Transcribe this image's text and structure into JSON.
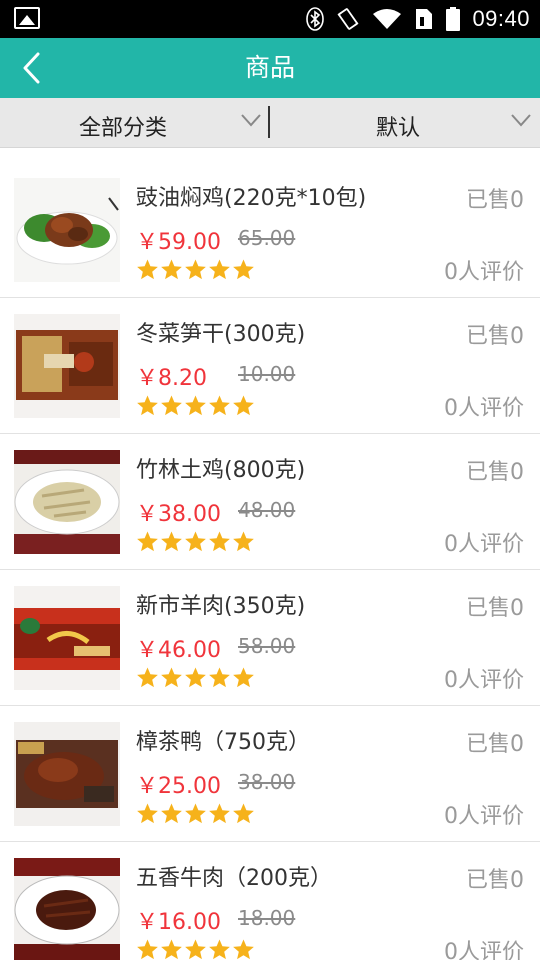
{
  "status_bar": {
    "time": "09:40",
    "icons": [
      "image-icon",
      "bluetooth-icon",
      "vibrate-icon",
      "wifi-icon",
      "sim-icon",
      "battery-icon"
    ]
  },
  "app_bar": {
    "title": "商品",
    "back_icon": "chevron-left-icon"
  },
  "filters": {
    "category": "全部分类",
    "sort": "默认"
  },
  "colors": {
    "accent": "#22b6a8",
    "price": "#f0343b",
    "star": "#f6b21b"
  },
  "products": [
    {
      "name": "豉油焖鸡(220克*10包)",
      "price": "￥59.00",
      "original_price": "65.00",
      "sold": "已售0",
      "reviews": "0人评价",
      "rating": 5
    },
    {
      "name": "冬菜笋干(300克)",
      "price": "￥8.20",
      "original_price": "10.00",
      "sold": "已售0",
      "reviews": "0人评价",
      "rating": 5
    },
    {
      "name": "竹林土鸡(800克)",
      "price": "￥38.00",
      "original_price": "48.00",
      "sold": "已售0",
      "reviews": "0人评价",
      "rating": 5
    },
    {
      "name": "新市羊肉(350克)",
      "price": "￥46.00",
      "original_price": "58.00",
      "sold": "已售0",
      "reviews": "0人评价",
      "rating": 5
    },
    {
      "name": "樟茶鸭（750克）",
      "price": "￥25.00",
      "original_price": "38.00",
      "sold": "已售0",
      "reviews": "0人评价",
      "rating": 5
    },
    {
      "name": "五香牛肉（200克）",
      "price": "￥16.00",
      "original_price": "18.00",
      "sold": "已售0",
      "reviews": "0人评价",
      "rating": 5
    }
  ]
}
